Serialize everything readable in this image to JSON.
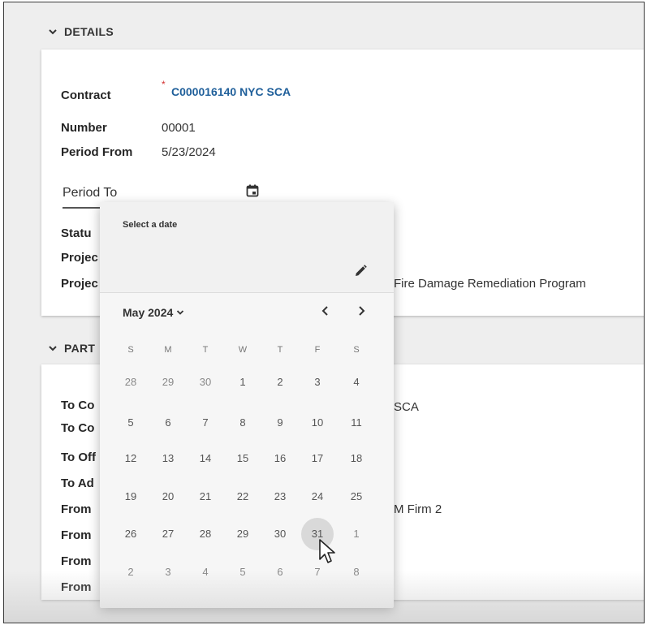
{
  "details": {
    "header": "DETAILS",
    "contract_label": "Contract",
    "contract_required": "*",
    "contract_value": "C000016140 NYC SCA",
    "number_label": "Number",
    "number_value": "00001",
    "period_from_label": "Period From",
    "period_from_value": "5/23/2024",
    "period_to_label": "Period To",
    "status_label": "Statu",
    "project_label_1": "Projec",
    "project_label_2": "Projec",
    "project_value": "Fire Damage Remediation Program"
  },
  "parties": {
    "header": "PART",
    "labels": [
      "To Co",
      "To Co",
      "To Off",
      "To Ad",
      "From",
      "From",
      "From",
      "From"
    ],
    "to_company_value": "SCA",
    "from_value": "M Firm 2"
  },
  "datepicker": {
    "title": "Select a date",
    "month_label": "May 2024",
    "weekdays": [
      "S",
      "M",
      "T",
      "W",
      "T",
      "F",
      "S"
    ],
    "weeks": [
      [
        "28",
        "29",
        "30",
        "1",
        "2",
        "3",
        "4"
      ],
      [
        "5",
        "6",
        "7",
        "8",
        "9",
        "10",
        "11"
      ],
      [
        "12",
        "13",
        "14",
        "15",
        "16",
        "17",
        "18"
      ],
      [
        "19",
        "20",
        "21",
        "22",
        "23",
        "24",
        "25"
      ],
      [
        "26",
        "27",
        "28",
        "29",
        "30",
        "31",
        "1"
      ],
      [
        "2",
        "3",
        "4",
        "5",
        "6",
        "7",
        "8"
      ]
    ],
    "hovered_day": "31"
  },
  "icons": {
    "section_toggle": "chevron-down-icon",
    "calendar": "calendar-icon",
    "edit": "pencil-icon",
    "prev": "chevron-left-icon",
    "next": "chevron-right-icon",
    "cursor": "mouse-pointer-icon"
  },
  "colors": {
    "link": "#1f5f9a",
    "required": "#d32f2f",
    "hover_day": "#d9d9d9",
    "background": "#eeeeee"
  }
}
